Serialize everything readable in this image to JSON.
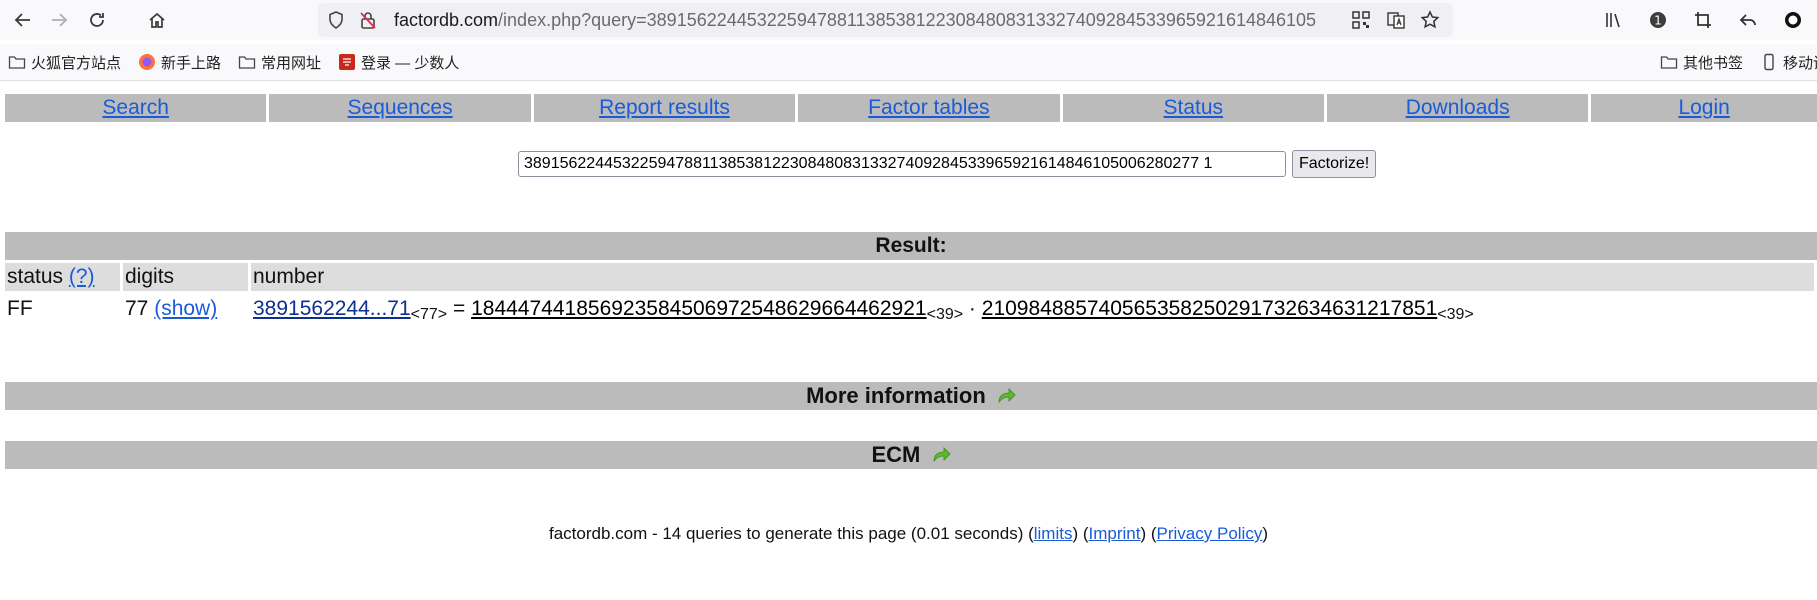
{
  "browser": {
    "url_host": "factordb.com",
    "url_path": "/index.php?query=3891562244532259478811385381223084808313327409284533965921614846105",
    "bookmarks": [
      "火狐官方站点",
      "新手上路",
      "常用网址",
      "登录 — 少数人"
    ],
    "bookmarks_right": [
      "其他书签",
      "移动设"
    ]
  },
  "nav": {
    "items": [
      "Search",
      "Sequences",
      "Report results",
      "Factor tables",
      "Status",
      "Downloads",
      "Login"
    ]
  },
  "search": {
    "query_value": "3891562244532259478811385381223084808313327409284533965921614846105006280277 1",
    "button_label": "Factorize!"
  },
  "result": {
    "heading": "Result:",
    "columns": {
      "status": "status",
      "help": "(?)",
      "digits": "digits",
      "number": "number"
    },
    "row": {
      "status": "FF",
      "digits": "77",
      "show": "(show)",
      "number_link": "3891562244...71",
      "number_digits": "<77>",
      "equals": "=",
      "factor1": "184447441856923584506972548629664462921",
      "factor1_digits": "<39>",
      "dot": "·",
      "factor2": "210984885740565358250291732634631217851",
      "factor2_digits": "<39>"
    }
  },
  "sections": {
    "more_info": "More information",
    "ecm": "ECM"
  },
  "footer": {
    "text": "factordb.com - 14 queries to generate this page (0.01 seconds) (",
    "limits": "limits",
    "sep1": ") (",
    "imprint": "Imprint",
    "sep2": ") (",
    "privacy": "Privacy Policy",
    "end": ")"
  },
  "colors": {
    "nav_bg": "#bbbbbb",
    "header_bg": "#dddddd",
    "link": "#1a5bd8",
    "arrow": "#5cb82e"
  }
}
